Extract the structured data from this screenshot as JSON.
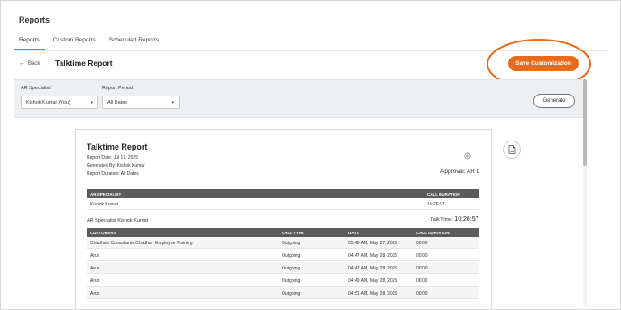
{
  "page": {
    "heading": "Reports"
  },
  "tabs": [
    {
      "label": "Reports",
      "active": true
    },
    {
      "label": "Custom Reports",
      "active": false
    },
    {
      "label": "Scheduled Reports",
      "active": false
    }
  ],
  "header": {
    "back_label": "Back",
    "report_name": "Talktime Report",
    "save_label": "Save Customization"
  },
  "filters": {
    "specialist_label": "AR Specialist*",
    "specialist_value": "Kishok Kumar (You)",
    "period_label": "Report Period",
    "period_value": "All Dates",
    "generate_label": "Generate"
  },
  "report": {
    "title": "Talktime Report",
    "date_line": "Report Date: Jul 17, 2025",
    "generated_by": "Generated By: Kishok Kumar",
    "duration_line": "Report Duration: All Dates",
    "approval": "Approval: AR 1",
    "summary_headers": [
      "AR SPECIALIST",
      "CALL DURATION"
    ],
    "summary_rows": [
      [
        "Kishok Kumar",
        "10:26:57"
      ]
    ],
    "specialist_section": "AR Specialist Kishok Kumar",
    "talk_time_label": "Talk Time:",
    "talk_time_value": "10:26:57",
    "detail_headers": [
      "CUSTOMERS",
      "CALL TYPE",
      "DATE",
      "CALL DURATION"
    ],
    "detail_rows": [
      [
        "Chadha's Consultants:Chadha - Employee Training",
        "Outgoing",
        "05:48 AM, May 27, 2025",
        "00:00"
      ],
      [
        "Arun",
        "Outgoing",
        "04:47 AM, May 28, 2025",
        "00:00"
      ],
      [
        "Arun",
        "Outgoing",
        "04:47 AM, May 28, 2025",
        "00:00"
      ],
      [
        "Arun",
        "Outgoing",
        "04:49 AM, May 28, 2025",
        "00:00"
      ],
      [
        "Arun",
        "Outgoing",
        "04:51 AM, May 28, 2025",
        "00:00"
      ]
    ]
  },
  "colors": {
    "accent": "#e86a1c",
    "table_header": "#5b5b5b",
    "filter_bar": "#edf0f3"
  },
  "icons": {
    "back": "arrow-left-icon",
    "dropdown": "chevron-down-icon",
    "export": "document-icon",
    "settings": "settings-icon"
  }
}
